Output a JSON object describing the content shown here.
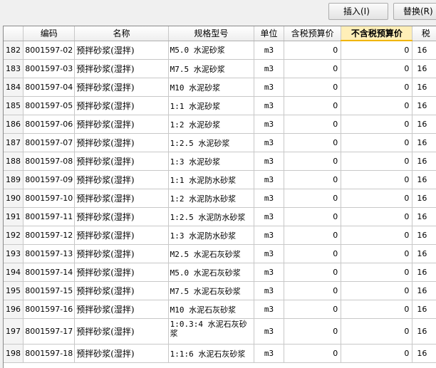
{
  "toolbar": {
    "insert_label": "插入(I)",
    "replace_label": "替换(R)"
  },
  "table": {
    "headers": {
      "index": "",
      "code": "编码",
      "name": "名称",
      "spec": "规格型号",
      "unit": "单位",
      "taxed_price": "含税预算价",
      "untaxed_price": "不含税预算价",
      "tax": "税"
    },
    "rows": [
      {
        "index": "182",
        "code": "8001597-02",
        "name": "预拌砂浆(湿拌)",
        "spec": "M5.0 水泥砂浆",
        "unit": "m3",
        "taxed": "0",
        "untaxed": "0",
        "tax": "16"
      },
      {
        "index": "183",
        "code": "8001597-03",
        "name": "预拌砂浆(湿拌)",
        "spec": "M7.5 水泥砂浆",
        "unit": "m3",
        "taxed": "0",
        "untaxed": "0",
        "tax": "16"
      },
      {
        "index": "184",
        "code": "8001597-04",
        "name": "预拌砂浆(湿拌)",
        "spec": "M10 水泥砂浆",
        "unit": "m3",
        "taxed": "0",
        "untaxed": "0",
        "tax": "16"
      },
      {
        "index": "185",
        "code": "8001597-05",
        "name": "预拌砂浆(湿拌)",
        "spec": "1:1 水泥砂浆",
        "unit": "m3",
        "taxed": "0",
        "untaxed": "0",
        "tax": "16"
      },
      {
        "index": "186",
        "code": "8001597-06",
        "name": "预拌砂浆(湿拌)",
        "spec": "1:2 水泥砂浆",
        "unit": "m3",
        "taxed": "0",
        "untaxed": "0",
        "tax": "16"
      },
      {
        "index": "187",
        "code": "8001597-07",
        "name": "预拌砂浆(湿拌)",
        "spec": "1:2.5 水泥砂浆",
        "unit": "m3",
        "taxed": "0",
        "untaxed": "0",
        "tax": "16"
      },
      {
        "index": "188",
        "code": "8001597-08",
        "name": "预拌砂浆(湿拌)",
        "spec": "1:3 水泥砂浆",
        "unit": "m3",
        "taxed": "0",
        "untaxed": "0",
        "tax": "16"
      },
      {
        "index": "189",
        "code": "8001597-09",
        "name": "预拌砂浆(湿拌)",
        "spec": "1:1 水泥防水砂浆",
        "unit": "m3",
        "taxed": "0",
        "untaxed": "0",
        "tax": "16"
      },
      {
        "index": "190",
        "code": "8001597-10",
        "name": "预拌砂浆(湿拌)",
        "spec": "1:2 水泥防水砂浆",
        "unit": "m3",
        "taxed": "0",
        "untaxed": "0",
        "tax": "16"
      },
      {
        "index": "191",
        "code": "8001597-11",
        "name": "预拌砂浆(湿拌)",
        "spec": "1:2.5 水泥防水砂浆",
        "unit": "m3",
        "taxed": "0",
        "untaxed": "0",
        "tax": "16"
      },
      {
        "index": "192",
        "code": "8001597-12",
        "name": "预拌砂浆(湿拌)",
        "spec": "1:3 水泥防水砂浆",
        "unit": "m3",
        "taxed": "0",
        "untaxed": "0",
        "tax": "16"
      },
      {
        "index": "193",
        "code": "8001597-13",
        "name": "预拌砂浆(湿拌)",
        "spec": "M2.5 水泥石灰砂浆",
        "unit": "m3",
        "taxed": "0",
        "untaxed": "0",
        "tax": "16"
      },
      {
        "index": "194",
        "code": "8001597-14",
        "name": "预拌砂浆(湿拌)",
        "spec": "M5.0 水泥石灰砂浆",
        "unit": "m3",
        "taxed": "0",
        "untaxed": "0",
        "tax": "16"
      },
      {
        "index": "195",
        "code": "8001597-15",
        "name": "预拌砂浆(湿拌)",
        "spec": "M7.5 水泥石灰砂浆",
        "unit": "m3",
        "taxed": "0",
        "untaxed": "0",
        "tax": "16"
      },
      {
        "index": "196",
        "code": "8001597-16",
        "name": "预拌砂浆(湿拌)",
        "spec": "M10 水泥石灰砂浆",
        "unit": "m3",
        "taxed": "0",
        "untaxed": "0",
        "tax": "16"
      },
      {
        "index": "197",
        "code": "8001597-17",
        "name": "预拌砂浆(湿拌)",
        "spec": "1:0.3:4 水泥石灰砂浆",
        "unit": "m3",
        "taxed": "0",
        "untaxed": "0",
        "tax": "16"
      },
      {
        "index": "198",
        "code": "8001597-18",
        "name": "预拌砂浆(湿拌)",
        "spec": "1:1:6 水泥石灰砂浆",
        "unit": "m3",
        "taxed": "0",
        "untaxed": "0",
        "tax": "16"
      }
    ]
  }
}
